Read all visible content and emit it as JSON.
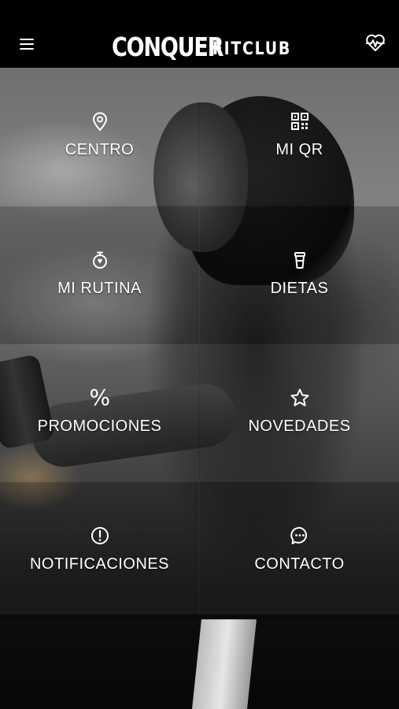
{
  "header": {
    "logo_main": "CONQUER",
    "logo_sub": "FITCLUB"
  },
  "tiles": [
    {
      "label": "CENTRO",
      "icon": "location-pin-icon"
    },
    {
      "label": "MI QR",
      "icon": "qr-code-icon"
    },
    {
      "label": "MI RUTINA",
      "icon": "stopwatch-icon"
    },
    {
      "label": "DIETAS",
      "icon": "cup-icon"
    },
    {
      "label": "PROMOCIONES",
      "icon": "percent-icon",
      "glyph": "%"
    },
    {
      "label": "NOVEDADES",
      "icon": "star-icon"
    },
    {
      "label": "NOTIFICACIONES",
      "icon": "alert-circle-icon"
    },
    {
      "label": "CONTACTO",
      "icon": "chat-bubble-icon"
    }
  ],
  "colors": {
    "header_bg": "#000000",
    "text": "#ffffff"
  }
}
